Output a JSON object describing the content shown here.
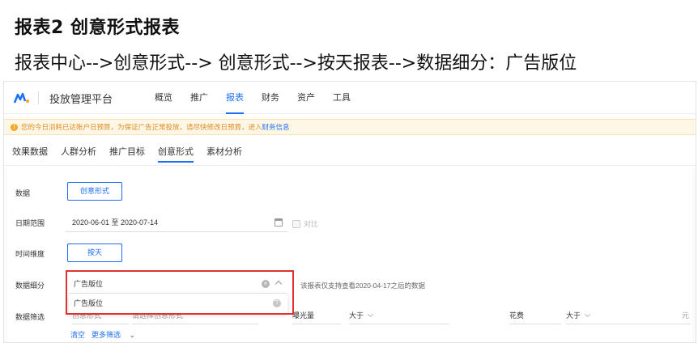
{
  "doc": {
    "title": "报表2  创意形式报表",
    "path": "报表中心-->创意形式--> 创意形式-->按天报表-->数据细分：广告版位"
  },
  "app": {
    "name": "投放管理平台",
    "nav": [
      "概览",
      "推广",
      "报表",
      "财务",
      "资产",
      "工具"
    ],
    "active_nav": "报表"
  },
  "notice": {
    "text": "您的今日消耗已达账户日预算，为保证广告正常投放，请尽快修改日预算，进入",
    "link": "财务信息"
  },
  "subtabs": [
    "效果数据",
    "人群分析",
    "推广目标",
    "创意形式",
    "素材分析"
  ],
  "active_subtab": "创意形式",
  "form": {
    "data_label": "数据",
    "data_button": "创意形式",
    "date_label": "日期范围",
    "date_value": "2020-06-01 至 2020-07-14",
    "compare_label": "对比",
    "time_label": "时间维度",
    "time_button": "按天",
    "breakdown_label": "数据细分",
    "breakdown_value": "广告版位",
    "breakdown_hint": "该报表仅支持查看2020-04-17之后的数据",
    "dropdown_option": "广告版位",
    "filter_label": "数据筛选",
    "filter_field1": "创意形式",
    "filter_field1_placeholder": "请选择创意形式",
    "filter_exposure_label": "曝光量",
    "filter_gt": "大于",
    "filter_cost_label": "花费",
    "filter_unit": "元",
    "clear_link": "清空",
    "more_link": "更多筛选"
  },
  "colors": {
    "accent": "#1e6ff5",
    "highlight": "#e0332f",
    "warning": "#f5a623"
  }
}
